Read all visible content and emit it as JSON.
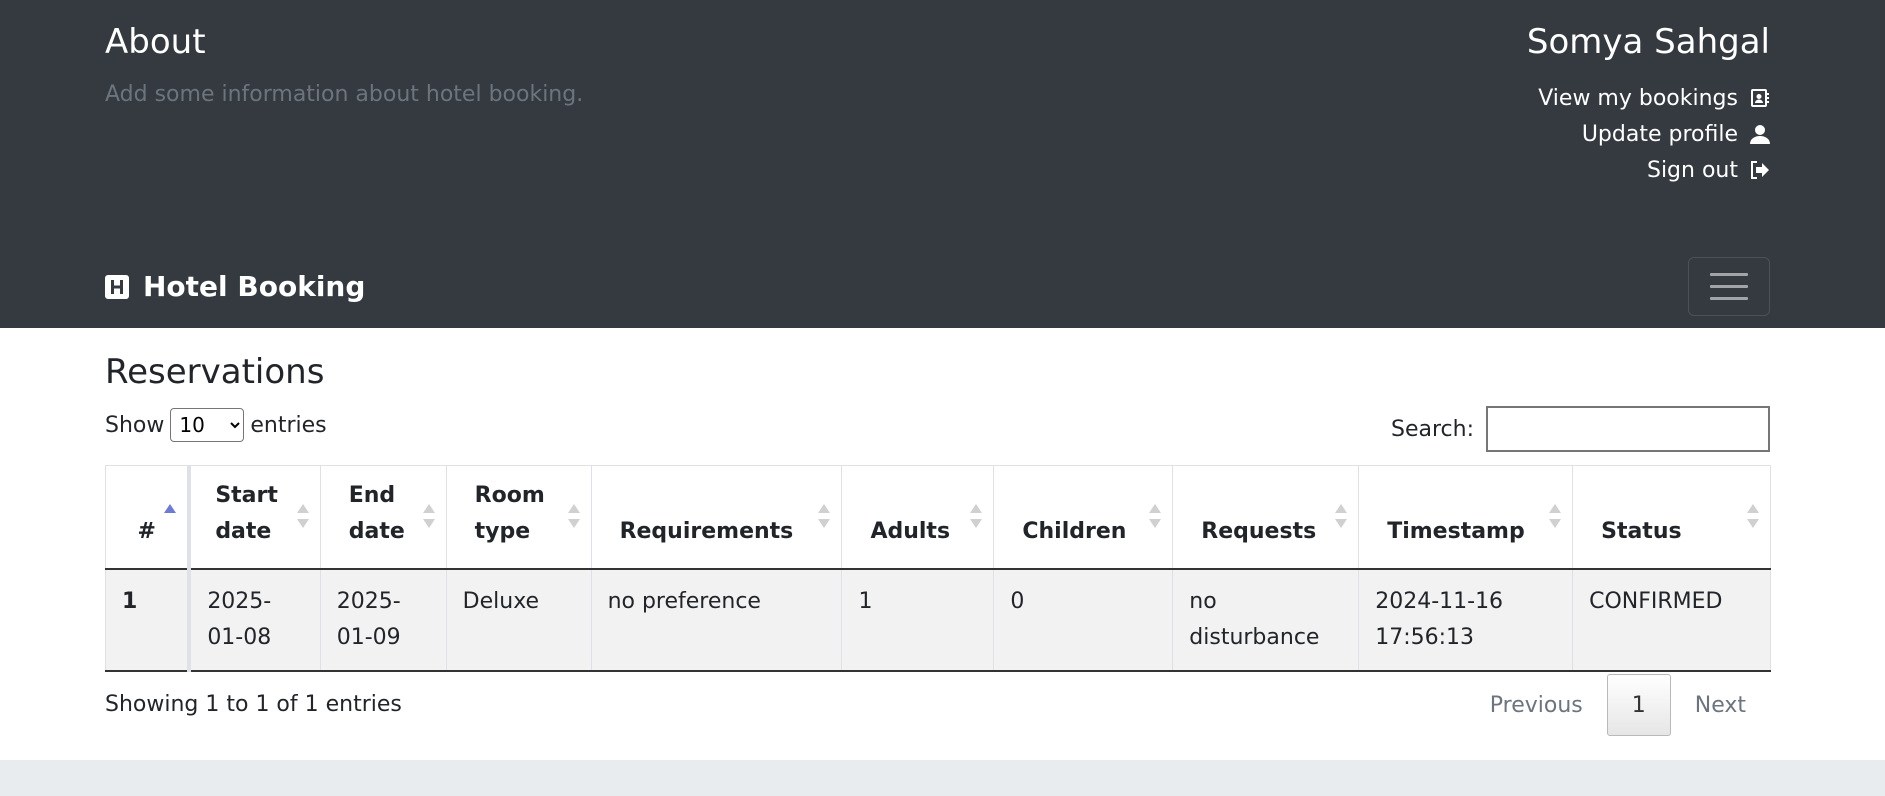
{
  "about": {
    "title": "About",
    "text": "Add some information about hotel booking."
  },
  "user": {
    "name": "Somya Sahgal",
    "links": [
      {
        "label": "View my bookings",
        "icon": "address-book-icon"
      },
      {
        "label": "Update profile",
        "icon": "user-icon"
      },
      {
        "label": "Sign out",
        "icon": "sign-out-icon"
      }
    ]
  },
  "navbar": {
    "brand": "Hotel Booking",
    "brand_icon": "hospital-h-icon",
    "toggler_icon": "hamburger-menu-icon"
  },
  "reservations": {
    "title": "Reservations",
    "show_label": "Show",
    "entries_label": "entries",
    "page_size": "10",
    "search_label": "Search:",
    "search_value": "",
    "columns": [
      "#",
      "Start date",
      "End date",
      "Room type",
      "Requirements",
      "Adults",
      "Children",
      "Requests",
      "Timestamp",
      "Status"
    ],
    "rows": [
      [
        "1",
        "2025-01-08",
        "2025-01-09",
        "Deluxe",
        "no preference",
        "1",
        "0",
        "no disturbance",
        "2024-11-16 17:56:13",
        "CONFIRMED"
      ]
    ],
    "info": "Showing 1 to 1 of 1 entries",
    "pagination": {
      "previous": "Previous",
      "current": "1",
      "next": "Next"
    }
  },
  "colors": {
    "header_bg": "#343a40",
    "muted_text": "#6c757d",
    "sort_active": "#6e7bd1",
    "footer_bg": "#e9ecef"
  }
}
